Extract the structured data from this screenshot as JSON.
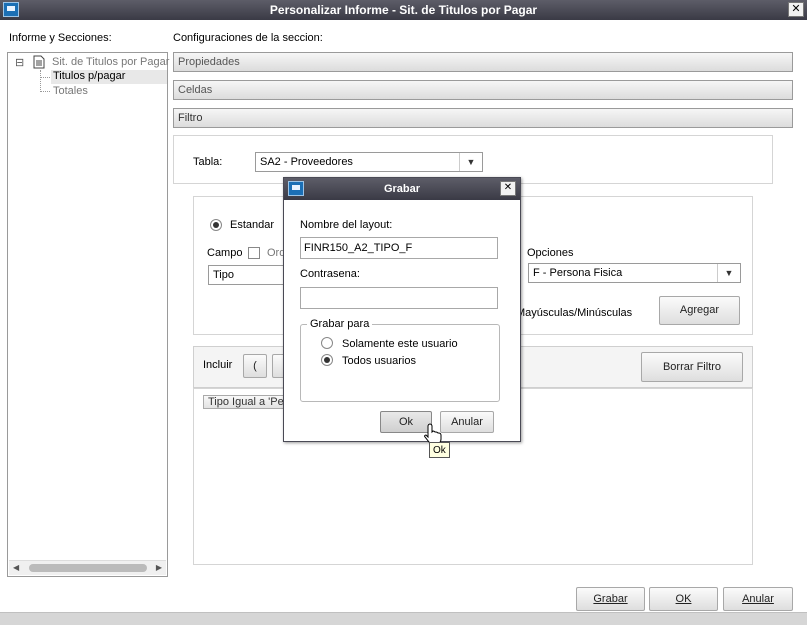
{
  "window": {
    "title": "Personalizar Informe - Sit. de Titulos por Pagar",
    "close_glyph": "✕"
  },
  "left": {
    "heading": "Informe y Secciones:",
    "tree": {
      "toggle": "⊟",
      "root": "Sit. de Titulos por Pagar",
      "children": [
        "Titulos p/pagar",
        "Totales"
      ]
    }
  },
  "right": {
    "heading": "Configuraciones de la seccion:",
    "sections": [
      "Propiedades",
      "Celdas",
      "Filtro"
    ],
    "tabla_label": "Tabla:",
    "tabla_value": "SA2 - Proveedores",
    "estandar_label": "Estandar",
    "campo_label": "Campo",
    "orden_label": "Ord",
    "campo_value": "Tipo",
    "opciones_label": "Opciones",
    "opciones_value": "F - Persona Fisica",
    "mayus_label": "Mayúsculas/Minúsculas",
    "agregar_label": "Agregar",
    "incluir_label": "Incluir",
    "paren_label": "(",
    "borrar_label": "Borrar Filtro",
    "filter_chip": "Tipo Igual a 'Pe"
  },
  "footer": {
    "grabar": "Grabar",
    "ok": "OK",
    "anular": "Anular"
  },
  "dialog": {
    "title": "Grabar",
    "close_glyph": "✕",
    "layout_label": "Nombre del layout:",
    "layout_value": "FINR150_A2_TIPO_F",
    "password_label": "Contrasena:",
    "password_value": "",
    "group_label": "Grabar para",
    "options": [
      "Solamente este usuario",
      "Todos usuarios"
    ],
    "ok": "Ok",
    "anular": "Anular",
    "tooltip": "Ok"
  },
  "colors": {
    "titlebar": "#3a3a45",
    "selection": "#e8e8e8"
  }
}
